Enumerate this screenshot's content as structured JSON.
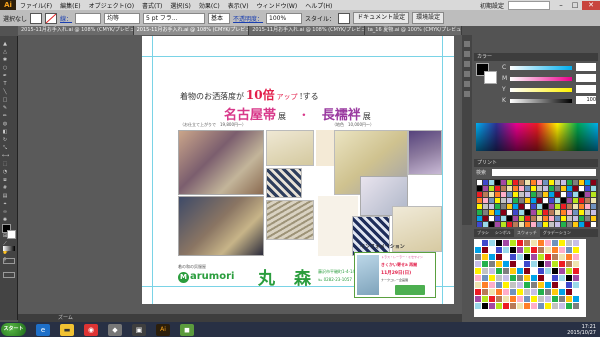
{
  "app": {
    "logo": "Ai"
  },
  "menu": [
    "ファイル(F)",
    "編集(E)",
    "オブジェクト(O)",
    "書式(T)",
    "選択(S)",
    "効果(C)",
    "表示(V)",
    "ウィンドウ(W)",
    "ヘルプ(H)"
  ],
  "menu_right": {
    "workspace": "初期設定",
    "minimize": "–",
    "maximize": "□",
    "close": "✕"
  },
  "control": {
    "selection": "選択なし",
    "stroke_label": "線：",
    "brush": "5 pt フラ...",
    "uniform": "均等",
    "basic": "基本",
    "opacity_label": "不透明度：",
    "opacity": "100%",
    "style_label": "スタイル：",
    "doc_setup": "ドキュメント設定",
    "prefs": "環境設定"
  },
  "tabs": [
    {
      "label": "2015-11月お手入れ.ai @ 108% (CMYK/プレビュー)",
      "active": false
    },
    {
      "label": "2015-11月お手入れ.ai @ 108% (CMYK/プレビュー)",
      "active": true
    },
    {
      "label": "2015-11月お手入れ.ai @ 108% (CMYK/プレビュー)",
      "active": false
    },
    {
      "label": "ta_16 夏物.ai @ 100% (CMYK/プレビュー)",
      "active": false
    }
  ],
  "status": {
    "zoom_label": "ズーム"
  },
  "flyer": {
    "headline": "着物のお洒落度が",
    "highlight": "10倍",
    "up": "アップ",
    "suffix": "!する",
    "nagoya": "名古屋帯",
    "ten1": "展",
    "dot": "・",
    "nagajuban": "長襦袢",
    "ten2": "展",
    "nagoya_price": "（お仕立て上がりで　19,800円〜）",
    "juban_price": "（地色　10,000円〜）",
    "info": "インフォメーション",
    "info_box_1": "トラス・レーラー・ミセヤイン",
    "info_box_2": "きくかい寄せa 再開",
    "info_box_date": "11月29日(日)",
    "info_box_3": "ナークコレー企画展",
    "shop_tag": "着の和の呉服屋",
    "logo_m": "M",
    "logo_text": "arumori",
    "maru": "丸",
    "mori": "森",
    "address": "藤沢市平磯町1-4-14",
    "tel": "℡ 0282-23-1057"
  },
  "panels": {
    "color_title": "カラー",
    "cmyk": [
      {
        "label": "C",
        "value": ""
      },
      {
        "label": "M",
        "value": ""
      },
      {
        "label": "Y",
        "value": ""
      },
      {
        "label": "K",
        "value": "100"
      }
    ],
    "swatch_tab": "プリント",
    "swatch_search": "検索",
    "brush_tabs": [
      "ブラシ",
      "シンボル",
      "スウォッチ",
      "グラデーション"
    ]
  },
  "taskbar": {
    "start": "スタート",
    "time": "17:21",
    "date": "2015/10/27"
  },
  "colors": {
    "accent": "#f7a21b",
    "red": "#e21f4a",
    "pink": "#d8388a",
    "green": "#2a9d3d",
    "purple": "#9a3aa0"
  }
}
